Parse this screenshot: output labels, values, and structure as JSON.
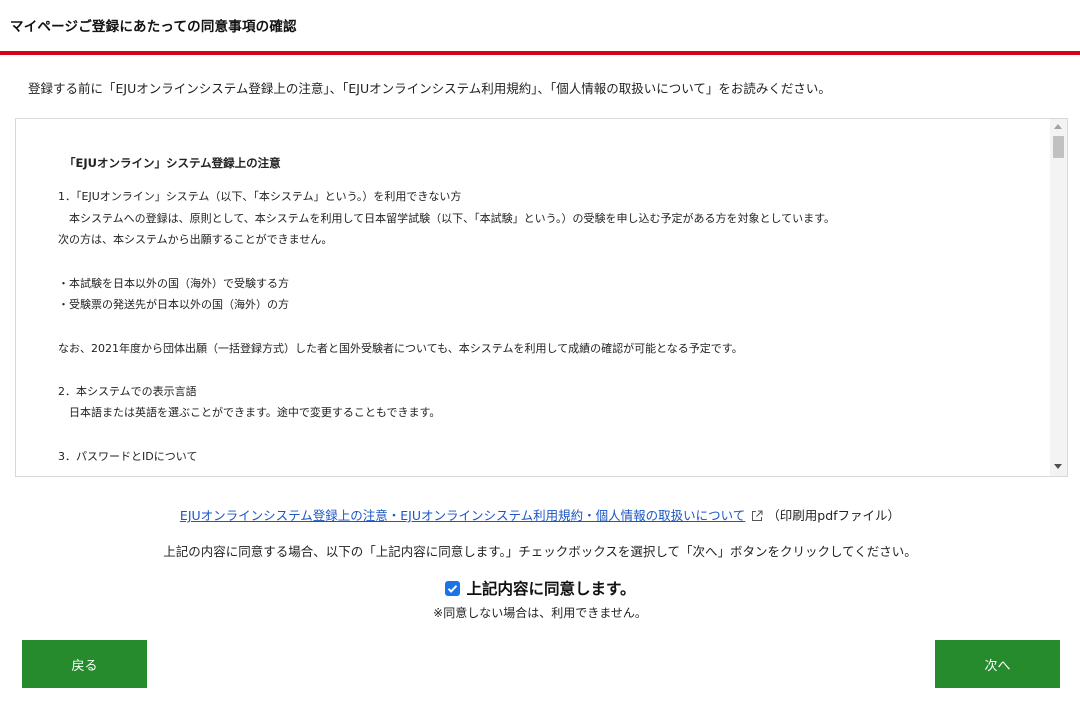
{
  "header": {
    "title": "マイページご登録にあたっての同意事項の確認"
  },
  "intro": "登録する前に「EJUオンラインシステム登録上の注意」、「EJUオンラインシステム利用規約」、「個人情報の取扱いについて」をお読みください。",
  "terms": {
    "heading": "「EJUオンライン」システム登録上の注意",
    "lines": [
      "1．「EJUオンライン」システム（以下、「本システム」という。）を利用できない方",
      "　本システムへの登録は、原則として、本システムを利用して日本留学試験（以下、「本試験」という。）の受験を申し込む予定がある方を対象としています。",
      "次の方は、本システムから出願することができません。",
      "・本試験を日本以外の国（海外）で受験する方",
      "・受験票の発送先が日本以外の国（海外）の方",
      "なお、2021年度から団体出願（一括登録方式）した者と国外受験者についても、本システムを利用して成績の確認が可能となる予定です。",
      "2．本システムでの表示言語",
      "　日本語または英語を選ぶことができます。途中で変更することもできます。",
      "3．パスワードとIDについて"
    ]
  },
  "pdf": {
    "link_text": "EJUオンラインシステム登録上の注意・EJUオンラインシステム利用規約・個人情報の取扱いについて",
    "note": "（印刷用pdfファイル）",
    "icon": "external-link-icon"
  },
  "instruction": "上記の内容に同意する場合、以下の「上記内容に同意します。」チェックボックスを選択して「次へ」ボタンをクリックしてください。",
  "agree": {
    "label": "上記内容に同意します。",
    "checked": true,
    "note": "※同意しない場合は、利用できません。"
  },
  "buttons": {
    "back": "戻る",
    "next": "次へ"
  },
  "colors": {
    "accent_red": "#d6001c",
    "button_green": "#258b2c",
    "link_blue": "#1a56c4",
    "checkbox_blue": "#1a73e8"
  }
}
